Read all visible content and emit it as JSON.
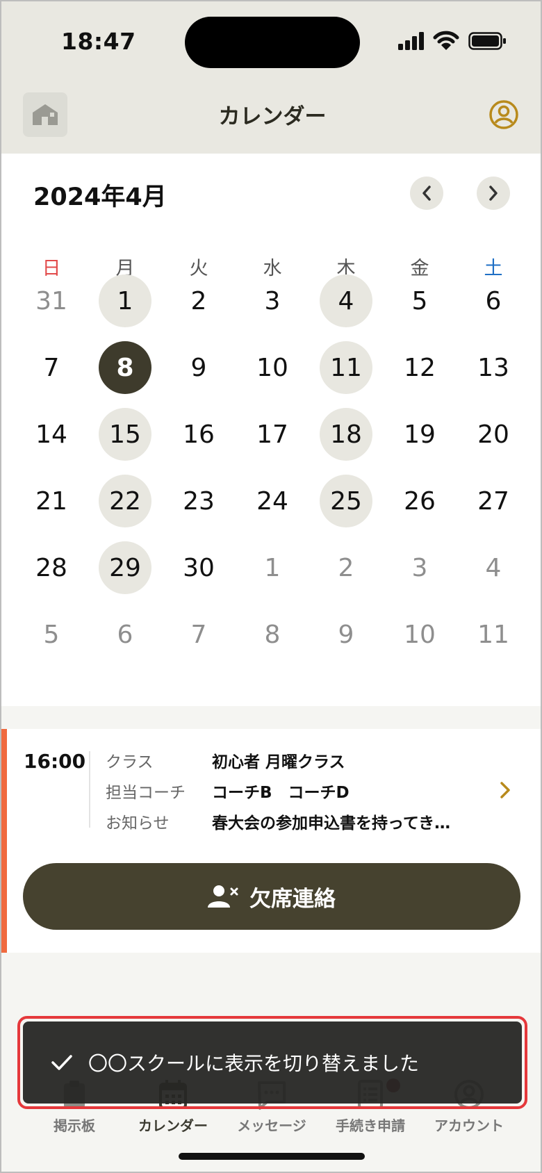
{
  "status_bar": {
    "time": "18:47"
  },
  "header": {
    "title": "カレンダー",
    "home_icon": "home-icon",
    "account_icon": "account-circle-icon"
  },
  "calendar": {
    "month_label": "2024年4月",
    "weekdays": [
      "日",
      "月",
      "火",
      "水",
      "木",
      "金",
      "土"
    ],
    "weeks": [
      [
        "31",
        "1",
        "2",
        "3",
        "4",
        "5",
        "6"
      ],
      [
        "7",
        "8",
        "9",
        "10",
        "11",
        "12",
        "13"
      ],
      [
        "14",
        "15",
        "16",
        "17",
        "18",
        "19",
        "20"
      ],
      [
        "21",
        "22",
        "23",
        "24",
        "25",
        "26",
        "27"
      ],
      [
        "28",
        "29",
        "30",
        "1",
        "2",
        "3",
        "4"
      ],
      [
        "5",
        "6",
        "7",
        "8",
        "9",
        "10",
        "11"
      ]
    ],
    "selected_date": "8",
    "marked_dates": [
      "1",
      "4",
      "11",
      "15",
      "18",
      "22",
      "25",
      "29"
    ]
  },
  "event": {
    "time": "16:00",
    "rows": [
      {
        "key": "クラス",
        "value": "初心者 月曜クラス"
      },
      {
        "key": "担当コーチ",
        "value": "コーチB　コーチD"
      },
      {
        "key": "お知らせ",
        "value": "春大会の参加申込書を持ってき…"
      }
    ],
    "absent_button": "欠席連絡"
  },
  "tabs": [
    {
      "label": "掲示板",
      "icon": "clipboard-icon"
    },
    {
      "label": "カレンダー",
      "icon": "calendar-icon",
      "active": true
    },
    {
      "label": "メッセージ",
      "icon": "message-icon"
    },
    {
      "label": "手続き申請",
      "icon": "form-list-icon",
      "badge": true
    },
    {
      "label": "アカウント",
      "icon": "account-icon"
    }
  ],
  "toast": {
    "message": "〇〇スクールに表示を切り替えました",
    "icon": "check-icon"
  },
  "colors": {
    "accent_dark": "#3e3b2c",
    "event_bar": "#f06a3f",
    "header_bg": "#e9e8e1",
    "toast_outline": "#e5383b",
    "gold": "#b88a1c"
  }
}
